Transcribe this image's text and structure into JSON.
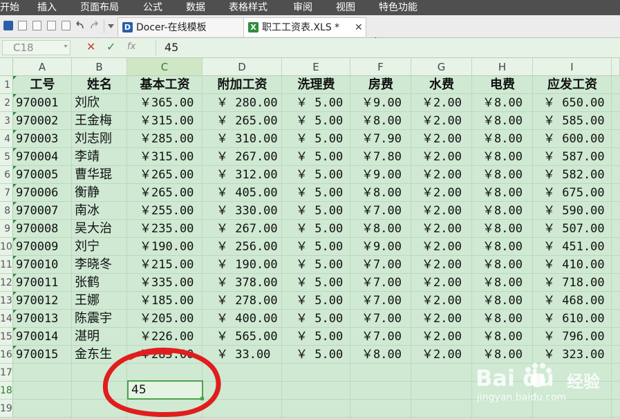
{
  "menu": [
    "开始",
    "插入",
    "页面布局",
    "公式",
    "数据",
    "表格样式",
    "审阅",
    "视图",
    "特色功能"
  ],
  "tabs": [
    {
      "label": "Docer-在线模板",
      "icon": "docer-icon"
    },
    {
      "label": "职工工资表.XLS *",
      "icon": "excel-file-icon"
    }
  ],
  "formula_bar": {
    "namebox": "C18",
    "fx": "fx",
    "value": "45"
  },
  "columns": [
    "A",
    "B",
    "C",
    "D",
    "E",
    "F",
    "G",
    "H",
    "I"
  ],
  "rows": [
    "1",
    "2",
    "3",
    "4",
    "5",
    "6",
    "7",
    "8",
    "9",
    "10",
    "11",
    "12",
    "13",
    "14",
    "15",
    "16",
    "17",
    "18",
    "19"
  ],
  "sheet": {
    "headers": [
      "工号",
      "姓名",
      "基本工资",
      "附加工资",
      "洗理费",
      "房费",
      "水费",
      "电费",
      "应发工资"
    ],
    "records": [
      [
        "970001",
        "刘欣",
        "￥365.00",
        "￥ 280.00",
        "￥ 5.00",
        "￥9.00",
        "￥2.00",
        "￥8.00",
        "￥ 650.00"
      ],
      [
        "970002",
        "王金梅",
        "￥315.00",
        "￥ 265.00",
        "￥ 5.00",
        "￥8.00",
        "￥2.00",
        "￥8.00",
        "￥ 585.00"
      ],
      [
        "970003",
        "刘志刚",
        "￥285.00",
        "￥ 310.00",
        "￥ 5.00",
        "￥7.90",
        "￥2.00",
        "￥8.00",
        "￥ 600.00"
      ],
      [
        "970004",
        "李靖",
        "￥315.00",
        "￥ 267.00",
        "￥ 5.00",
        "￥7.80",
        "￥2.00",
        "￥8.00",
        "￥ 587.00"
      ],
      [
        "970005",
        "曹华琨",
        "￥265.00",
        "￥ 312.00",
        "￥ 5.00",
        "￥9.00",
        "￥2.00",
        "￥8.00",
        "￥ 582.00"
      ],
      [
        "970006",
        "衡静",
        "￥265.00",
        "￥ 405.00",
        "￥ 5.00",
        "￥8.00",
        "￥2.00",
        "￥8.00",
        "￥ 675.00"
      ],
      [
        "970007",
        "南冰",
        "￥255.00",
        "￥ 330.00",
        "￥ 5.00",
        "￥7.00",
        "￥2.00",
        "￥8.00",
        "￥ 590.00"
      ],
      [
        "970008",
        "吴大治",
        "￥235.00",
        "￥ 267.00",
        "￥ 5.00",
        "￥8.00",
        "￥2.00",
        "￥8.00",
        "￥ 507.00"
      ],
      [
        "970009",
        "刘宁",
        "￥190.00",
        "￥ 256.00",
        "￥ 5.00",
        "￥9.00",
        "￥2.00",
        "￥8.00",
        "￥ 451.00"
      ],
      [
        "970010",
        "李晓冬",
        "￥215.00",
        "￥ 190.00",
        "￥ 5.00",
        "￥7.00",
        "￥2.00",
        "￥8.00",
        "￥ 410.00"
      ],
      [
        "970011",
        "张鹤",
        "￥335.00",
        "￥ 378.00",
        "￥ 5.00",
        "￥7.00",
        "￥2.00",
        "￥8.00",
        "￥ 718.00"
      ],
      [
        "970012",
        "王娜",
        "￥185.00",
        "￥ 278.00",
        "￥ 5.00",
        "￥7.00",
        "￥2.00",
        "￥8.00",
        "￥ 468.00"
      ],
      [
        "970013",
        "陈震宇",
        "￥205.00",
        "￥ 400.00",
        "￥ 5.00",
        "￥7.00",
        "￥2.00",
        "￥8.00",
        "￥ 610.00"
      ],
      [
        "970014",
        "湛明",
        "￥226.00",
        "￥ 565.00",
        "￥ 5.00",
        "￥7.00",
        "￥2.00",
        "￥8.00",
        "￥ 796.00"
      ],
      [
        "970015",
        "金东生",
        "￥285.00",
        "￥ 33.00",
        "￥ 5.00",
        "￥8.00",
        "￥2.00",
        "￥8.00",
        "￥ 323.00"
      ]
    ],
    "active_cell_value": "45"
  },
  "watermark": {
    "logo": "Bai du",
    "text": "经验",
    "url": "jingyan.baidu.com"
  },
  "colors": {
    "menubar": "#4f4f4f",
    "grid_bg": "#cfe9d3",
    "selection": "#4aa34a",
    "annotation": "#e11d1d"
  }
}
